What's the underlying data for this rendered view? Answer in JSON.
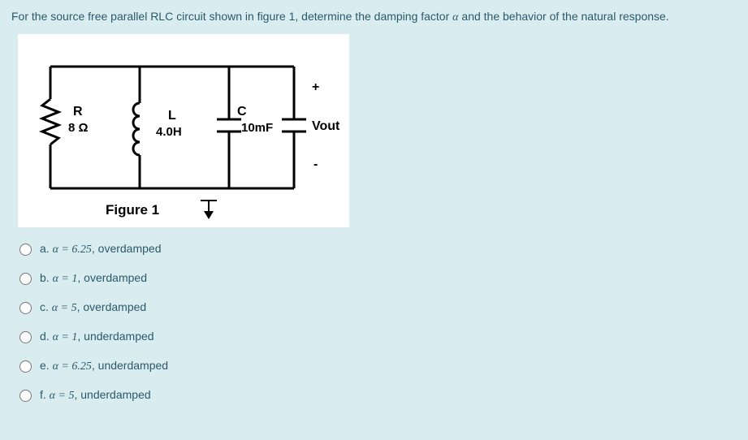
{
  "question": {
    "prefix": "For the source free parallel RLC circuit shown in figure 1, determine the damping factor ",
    "alpha": "α",
    "suffix": " and the behavior of the natural response."
  },
  "circuit": {
    "r_label": "R",
    "r_value": "8 Ω",
    "l_label": "L",
    "l_value": "4.0H",
    "c_label": "C",
    "c_value": "10mF",
    "vout_label": "Vout",
    "plus": "+",
    "minus": "-",
    "figure_label": "Figure 1"
  },
  "options": [
    {
      "letter": "a.",
      "alpha_expr": "α = 6.25",
      "behavior": ", overdamped"
    },
    {
      "letter": "b.",
      "alpha_expr": "α = 1",
      "behavior": ", overdamped"
    },
    {
      "letter": "c.",
      "alpha_expr": "α = 5",
      "behavior": ", overdamped"
    },
    {
      "letter": "d.",
      "alpha_expr": "α = 1",
      "behavior": ", underdamped"
    },
    {
      "letter": "e.",
      "alpha_expr": "α = 6.25",
      "behavior": ", underdamped"
    },
    {
      "letter": "f.",
      "alpha_expr": "α = 5",
      "behavior": ", underdamped"
    }
  ]
}
